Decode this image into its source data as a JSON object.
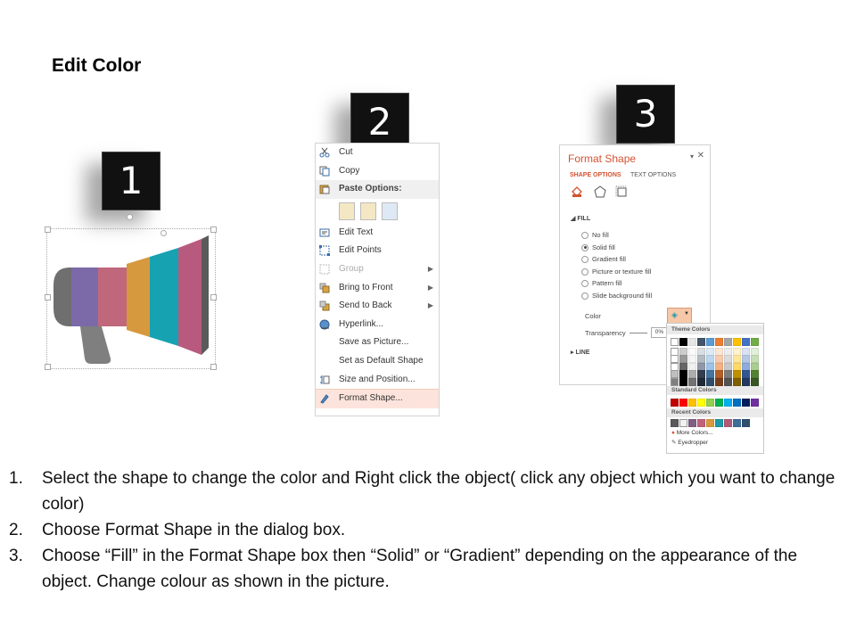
{
  "title": "Edit Color",
  "badges": [
    "1",
    "2",
    "3"
  ],
  "context_menu": {
    "items": [
      {
        "label": "Cut",
        "type": "item"
      },
      {
        "label": "Copy",
        "type": "item"
      },
      {
        "label": "Paste Options:",
        "type": "header"
      },
      {
        "label": "Edit Text",
        "type": "item"
      },
      {
        "label": "Edit Points",
        "type": "item"
      },
      {
        "label": "Group",
        "type": "disabled",
        "submenu": true
      },
      {
        "label": "Bring to Front",
        "type": "item",
        "submenu": true
      },
      {
        "label": "Send to Back",
        "type": "item",
        "submenu": true
      },
      {
        "label": "Hyperlink...",
        "type": "item"
      },
      {
        "label": "Save as Picture...",
        "type": "item"
      },
      {
        "label": "Set as Default Shape",
        "type": "item"
      },
      {
        "label": "Size and Position...",
        "type": "item"
      },
      {
        "label": "Format Shape...",
        "type": "highlighted"
      }
    ]
  },
  "format_panel": {
    "title": "Format Shape",
    "tabs": [
      "SHAPE OPTIONS",
      "TEXT OPTIONS"
    ],
    "section_fill": "FILL",
    "section_line": "LINE",
    "fill_options": [
      "No fill",
      "Solid fill",
      "Gradient fill",
      "Picture or texture fill",
      "Pattern fill",
      "Slide background fill"
    ],
    "selected_fill": "Solid fill",
    "color_label": "Color",
    "transparency_label": "Transparency",
    "transparency_value": "0%"
  },
  "color_picker": {
    "theme_label": "Theme Colors",
    "standard_label": "Standard Colors",
    "recent_label": "Recent Colors",
    "more_colors": "More Colors...",
    "eyedropper": "Eyedropper",
    "theme_colors": [
      "#ffffff",
      "#000000",
      "#e7e6e6",
      "#44546a",
      "#5b9bd5",
      "#ed7d31",
      "#a5a5a5",
      "#ffc000",
      "#4472c4",
      "#70ad47"
    ],
    "standard_colors": [
      "#c00000",
      "#ff0000",
      "#ffc000",
      "#ffff00",
      "#92d050",
      "#00b050",
      "#00b0f0",
      "#0070c0",
      "#002060",
      "#7030a0"
    ],
    "recent_colors": [
      "#595959",
      "#f2f2f2",
      "#7f6084",
      "#c0627a",
      "#d89a3e",
      "#1a9ba8",
      "#b05a7a",
      "#3f6e9a",
      "#2f4f6f"
    ]
  },
  "megaphone_colors": {
    "handle": "#7f7f7f",
    "back": "#6f6f6f",
    "seg1": "#7c6aa8",
    "seg2": "#c0677c",
    "seg3": "#d6993e",
    "seg4": "#17a2b1",
    "seg5": "#b75a7e",
    "rim": "#5a5a5a"
  },
  "steps": [
    {
      "num": "1.",
      "text": "Select the shape to change the color and Right click the object( click any object which you want to change color)"
    },
    {
      "num": "2.",
      "text": "Choose Format Shape in the dialog box."
    },
    {
      "num": "3.",
      "text": "Choose “Fill” in the Format Shape box then “Solid” or “Gradient” depending on the appearance of the object. Change colour as shown in the picture."
    }
  ]
}
